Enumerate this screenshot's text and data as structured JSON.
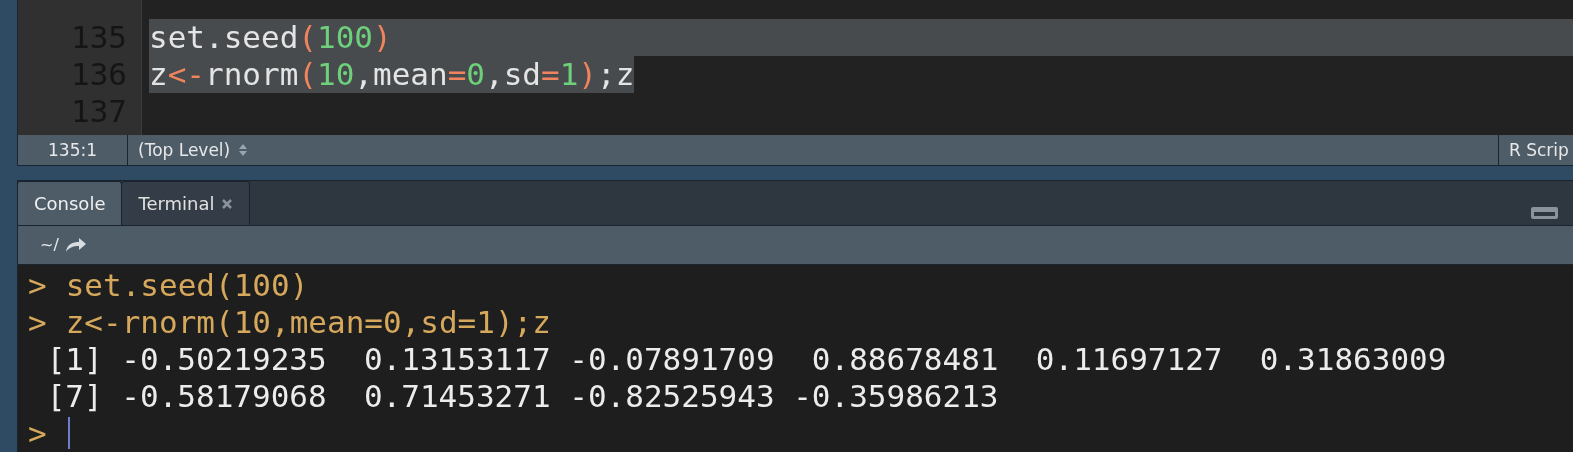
{
  "editor": {
    "lines": [
      {
        "number": "135",
        "selected": true,
        "tokens": [
          {
            "kind": "text",
            "text": "set.seed"
          },
          {
            "kind": "op",
            "text": "("
          },
          {
            "kind": "num",
            "text": "100"
          },
          {
            "kind": "op",
            "text": ")"
          }
        ]
      },
      {
        "number": "136",
        "selected": true,
        "tokens": [
          {
            "kind": "text",
            "text": "z"
          },
          {
            "kind": "op",
            "text": "<-"
          },
          {
            "kind": "text",
            "text": "rnorm"
          },
          {
            "kind": "op",
            "text": "("
          },
          {
            "kind": "num",
            "text": "10"
          },
          {
            "kind": "text",
            "text": ",mean"
          },
          {
            "kind": "op",
            "text": "="
          },
          {
            "kind": "num",
            "text": "0"
          },
          {
            "kind": "text",
            "text": ",sd"
          },
          {
            "kind": "op",
            "text": "="
          },
          {
            "kind": "num",
            "text": "1"
          },
          {
            "kind": "op",
            "text": ")"
          },
          {
            "kind": "text",
            "text": ";z"
          }
        ]
      },
      {
        "number": "137",
        "selected": false
      }
    ]
  },
  "status_bar": {
    "position": "135:1",
    "scope": "(Top Level)",
    "file_type": "R Scrip"
  },
  "tabs": [
    {
      "label": "Console",
      "selected": true,
      "closable": false
    },
    {
      "label": "Terminal",
      "selected": false,
      "closable": true
    }
  ],
  "console": {
    "path": "~/",
    "lines": [
      {
        "kind": "input",
        "prompt": ">",
        "text": "set.seed(100)"
      },
      {
        "kind": "input",
        "prompt": ">",
        "text": "z<-rnorm(10,mean=0,sd=1);z"
      },
      {
        "kind": "output",
        "text": " [1] -0.50219235  0.13153117 -0.07891709  0.88678481  0.11697127  0.31863009"
      },
      {
        "kind": "output",
        "text": " [7] -0.58179068  0.71453271 -0.82525943 -0.35986213"
      },
      {
        "kind": "prompt",
        "prompt": ">"
      }
    ]
  }
}
